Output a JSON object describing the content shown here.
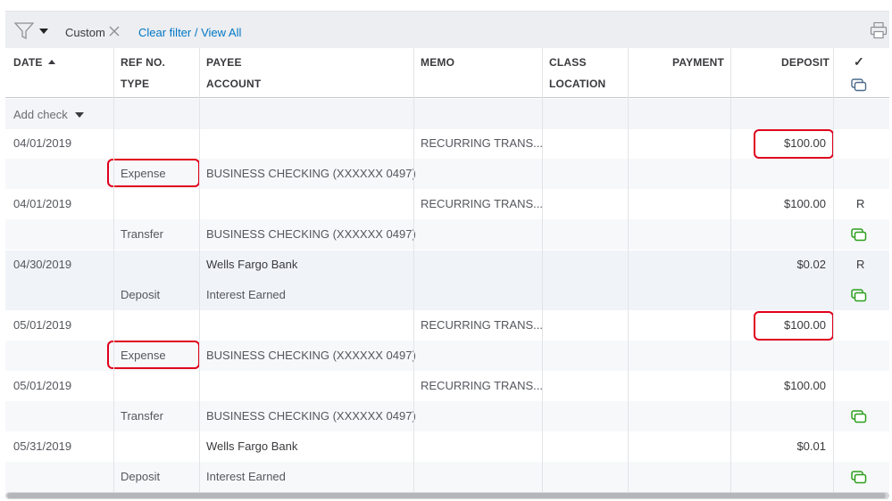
{
  "toolbar": {
    "filter_label": "Custom",
    "clear_filter": "Clear filter / View All"
  },
  "columns": {
    "date": "DATE",
    "ref_no": "REF NO.",
    "type": "TYPE",
    "payee": "PAYEE",
    "account": "ACCOUNT",
    "memo": "MEMO",
    "class": "CLASS",
    "location": "LOCATION",
    "payment": "PAYMENT",
    "deposit": "DEPOSIT",
    "check_glyph": "✓"
  },
  "add_row": {
    "label": "Add check"
  },
  "transactions": [
    {
      "date": "04/01/2019",
      "payee": "",
      "memo": "RECURRING TRANS...",
      "deposit": "$100.00",
      "status": "",
      "type": "Expense",
      "account": "BUSINESS CHECKING (XXXXXX 0497)",
      "highlighted": true,
      "attachment": false
    },
    {
      "date": "04/01/2019",
      "payee": "",
      "memo": "RECURRING TRANS...",
      "deposit": "$100.00",
      "status": "R",
      "type": "Transfer",
      "account": "BUSINESS CHECKING (XXXXXX 0497)",
      "highlighted": false,
      "attachment": true
    },
    {
      "date": "04/30/2019",
      "payee": "Wells Fargo Bank",
      "memo": "",
      "deposit": "$0.02",
      "status": "R",
      "type": "Deposit",
      "account": "Interest Earned",
      "highlighted": false,
      "attachment": true
    },
    {
      "date": "05/01/2019",
      "payee": "",
      "memo": "RECURRING TRANS...",
      "deposit": "$100.00",
      "status": "",
      "type": "Expense",
      "account": "BUSINESS CHECKING (XXXXXX 0497)",
      "highlighted": true,
      "attachment": false
    },
    {
      "date": "05/01/2019",
      "payee": "",
      "memo": "RECURRING TRANS...",
      "deposit": "$100.00",
      "status": "",
      "type": "Transfer",
      "account": "BUSINESS CHECKING (XXXXXX 0497)",
      "highlighted": false,
      "attachment": true
    },
    {
      "date": "05/31/2019",
      "payee": "Wells Fargo Bank",
      "memo": "",
      "deposit": "$0.01",
      "status": "",
      "type": "Deposit",
      "account": "Interest Earned",
      "highlighted": false,
      "attachment": true
    }
  ],
  "colors": {
    "highlight": "#e0001b",
    "link": "#0077c5",
    "attachment_icon": "#2ca01c",
    "header_icon": "#4a6a8a"
  }
}
